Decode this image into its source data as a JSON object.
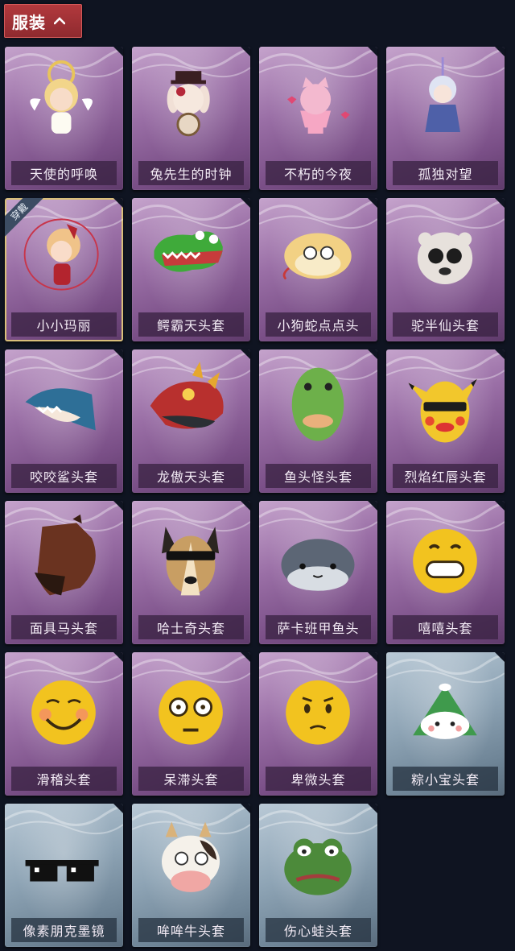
{
  "header": {
    "category_label": "服装",
    "toggle_icon": "chevron-up-icon"
  },
  "items": [
    {
      "label": "天使的呼唤",
      "rarity": "purple",
      "icon": "angel-doll-icon"
    },
    {
      "label": "兔先生的时钟",
      "rarity": "purple",
      "icon": "rabbit-clock-icon"
    },
    {
      "label": "不朽的今夜",
      "rarity": "purple",
      "icon": "cat-cup-icon"
    },
    {
      "label": "孤独对望",
      "rarity": "purple",
      "icon": "lonely-doll-icon"
    },
    {
      "label": "小小玛丽",
      "rarity": "purple",
      "icon": "little-mary-icon",
      "badge": "穿戴"
    },
    {
      "label": "鳄霸天头套",
      "rarity": "purple",
      "icon": "crocodile-head-icon"
    },
    {
      "label": "小狗蛇点点头",
      "rarity": "purple",
      "icon": "snake-head-icon"
    },
    {
      "label": "驼半仙头套",
      "rarity": "purple",
      "icon": "alpaca-head-icon"
    },
    {
      "label": "咬咬鲨头套",
      "rarity": "purple",
      "icon": "shark-head-icon"
    },
    {
      "label": "龙傲天头套",
      "rarity": "purple",
      "icon": "dragon-head-icon"
    },
    {
      "label": "鱼头怪头套",
      "rarity": "purple",
      "icon": "fish-head-icon"
    },
    {
      "label": "烈焰红唇头套",
      "rarity": "purple",
      "icon": "yellow-mouse-head-icon"
    },
    {
      "label": "面具马头套",
      "rarity": "purple",
      "icon": "horse-head-icon"
    },
    {
      "label": "哈士奇头套",
      "rarity": "purple",
      "icon": "husky-head-icon"
    },
    {
      "label": "萨卡班甲鱼头",
      "rarity": "purple",
      "icon": "sacabambaspis-head-icon"
    },
    {
      "label": "嘻嘻头套",
      "rarity": "purple",
      "icon": "grin-emoji-head-icon"
    },
    {
      "label": "滑稽头套",
      "rarity": "purple",
      "icon": "funny-emoji-head-icon"
    },
    {
      "label": "呆滞头套",
      "rarity": "purple",
      "icon": "dazed-emoji-head-icon"
    },
    {
      "label": "卑微头套",
      "rarity": "purple",
      "icon": "humble-emoji-head-icon"
    },
    {
      "label": "粽小宝头套",
      "rarity": "blue",
      "icon": "zongzi-head-icon"
    },
    {
      "label": "像素朋克墨镜",
      "rarity": "blue",
      "icon": "pixel-sunglasses-icon"
    },
    {
      "label": "哞哞牛头套",
      "rarity": "blue",
      "icon": "cow-head-icon"
    },
    {
      "label": "伤心蛙头套",
      "rarity": "blue",
      "icon": "sad-frog-head-icon"
    }
  ]
}
